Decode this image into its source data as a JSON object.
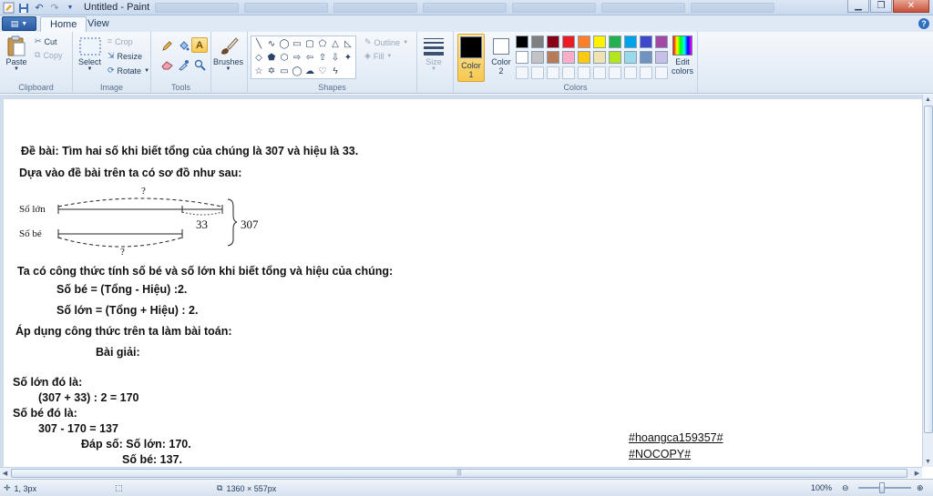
{
  "window": {
    "title": "Untitled - Paint"
  },
  "tabs": [
    "Home",
    "View"
  ],
  "groups": {
    "clipboard": {
      "label": "Clipboard",
      "paste": "Paste",
      "cut": "Cut",
      "copy": "Copy"
    },
    "image": {
      "label": "Image",
      "select": "Select",
      "crop": "Crop",
      "resize": "Resize",
      "rotate": "Rotate"
    },
    "tools": {
      "label": "Tools"
    },
    "brushes": {
      "label": "Brushes"
    },
    "shapes": {
      "label": "Shapes",
      "outline": "Outline",
      "fill": "Fill"
    },
    "size": {
      "label": "Size"
    },
    "colors": {
      "label": "Colors",
      "color1": "Color\n1",
      "color2": "Color\n2",
      "edit": "Edit\ncolors",
      "color1_value": "#000000",
      "color2_value": "#ffffff",
      "palette_row1": [
        "#000000",
        "#7f7f7f",
        "#880015",
        "#ed1c24",
        "#ff7f27",
        "#fff200",
        "#22b14c",
        "#00a2e8",
        "#3f48cc",
        "#a349a4"
      ],
      "palette_row2": [
        "#ffffff",
        "#c3c3c3",
        "#b97a57",
        "#ffaec9",
        "#ffc90e",
        "#efe4b0",
        "#b5e61d",
        "#99d9ea",
        "#7092be",
        "#c8bfe7"
      ]
    }
  },
  "canvas": {
    "lines": {
      "de_bai": "Đề bài: Tìm hai số khi biết tổng của chúng là 307 và hiệu là 33.",
      "dua_vao": "Dựa vào đề bài trên ta có sơ đồ như sau:",
      "cong_thuc": "Ta có công thức tính số bé và số lớn khi biết tổng và hiệu của chúng:",
      "so_be_ct": "Số bé = (Tổng - Hiệu) :2.",
      "so_lon_ct": "Số lớn = (Tổng + Hiệu) : 2.",
      "ap_dung": "Áp dụng công thức trên ta làm bài toán:",
      "bai_giai": "Bài giải:",
      "so_lon_la": "Số lớn đó là:",
      "calc_lon": "(307 + 33) : 2 = 170",
      "so_be_la": "Số bé đó là:",
      "calc_be": "307 - 170 = 137",
      "dap_so": "Đáp số: Số lớn: 170.",
      "dap_so_be": "Số bé: 137."
    },
    "diagram": {
      "label_lon": "Số lớn",
      "label_be": "Số bé",
      "q_top": "?",
      "q_bottom": "?",
      "diff": "33",
      "total": "307"
    },
    "tags": {
      "tag1": "#hoangca159357#",
      "tag2": "#NOCOPY#"
    }
  },
  "status": {
    "cursor": "1, 3px",
    "size": "1360 × 557px",
    "zoom": "100%"
  }
}
